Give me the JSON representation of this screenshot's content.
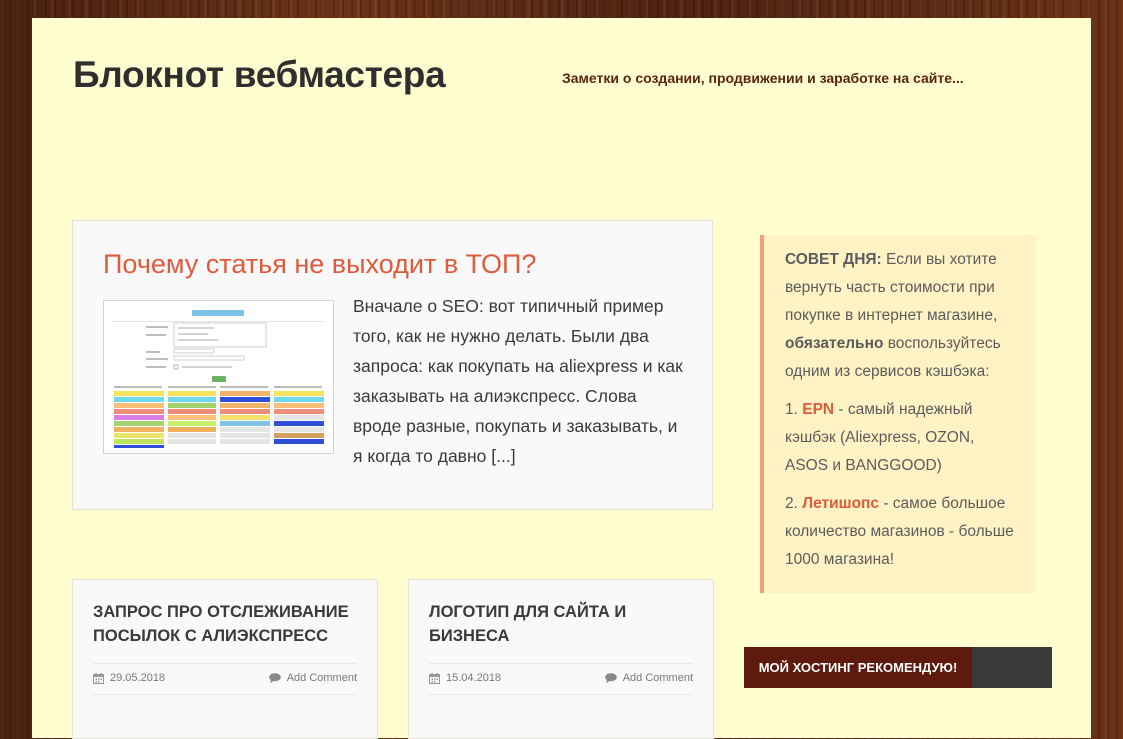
{
  "site": {
    "title": "Блокнот вебмастера",
    "tagline": "Заметки о создании, продвижении и заработке на сайте..."
  },
  "featured": {
    "title": "Почему статья не выходит в ТОП?",
    "excerpt": "Вначале о SEO: вот типичный пример того, как не нужно делать. Были два запроса: как покупать на aliexpress и как заказывать на алиэкспресс. Слова вроде разные, покупать и заказывать, и я когда то давно",
    "more": "[...]"
  },
  "posts": [
    {
      "title": "ЗАПРОС ПРО ОТСЛЕЖИВАНИЕ ПОСЫЛОК С АЛИЭКСПРЕСС",
      "date": "29.05.2018",
      "comment_label": "Add Comment"
    },
    {
      "title": "ЛОГОТИП ДЛЯ САЙТА И БИЗНЕСА",
      "date": "15.04.2018",
      "comment_label": "Add Comment"
    }
  ],
  "advice": {
    "label": "СОВЕТ ДНЯ:",
    "text1": " Если вы хотите вернуть часть стоимости при покупке в интернет магазине, ",
    "strong": "обязательно",
    "text2": " воспользуйтесь одним из сервисов кэшбэка:",
    "items": [
      {
        "num": "1. ",
        "name": "EPN",
        "desc": " - самый надежный кэшбэк (Aliexpress, OZON, ASOS и BANGGOOD)"
      },
      {
        "num": "2. ",
        "name": "Летишопс",
        "desc": " - самое большое количество магазинов - больше 1000 магазина!"
      }
    ]
  },
  "hosting": {
    "label": "МОЙ ХОСТИНГ РЕКОМЕНДУЮ!"
  },
  "icons": {
    "date": "calendar-icon",
    "comment": "comment-icon"
  },
  "colors": {
    "accent": "#e05a3c",
    "page_bg": "#fefed0",
    "dark_brown": "#5e1a0c",
    "advice_bg": "#fff2c4",
    "advice_border": "#f5a07c"
  }
}
